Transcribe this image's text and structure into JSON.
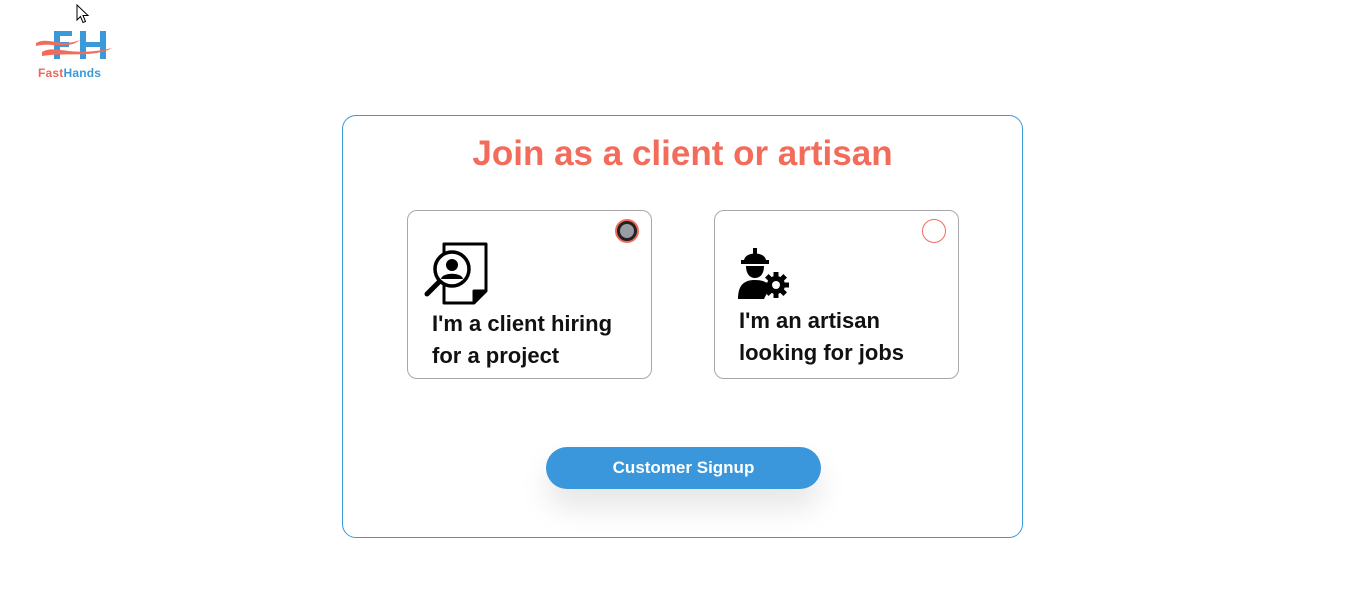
{
  "brand": {
    "logo_part1": "Fast",
    "logo_part2": "Hands",
    "primary_color": "#3a9ad9",
    "accent_color": "#f26b5b"
  },
  "card": {
    "title": "Join as a client or artisan"
  },
  "options": [
    {
      "id": "client",
      "label": "I'm a client hiring for a project",
      "icon": "client-search-document-icon",
      "selected": true
    },
    {
      "id": "artisan",
      "label": "I'm an artisan looking for jobs",
      "icon": "worker-gear-icon",
      "selected": false
    }
  ],
  "signup_button": {
    "label": "Customer Signup"
  }
}
